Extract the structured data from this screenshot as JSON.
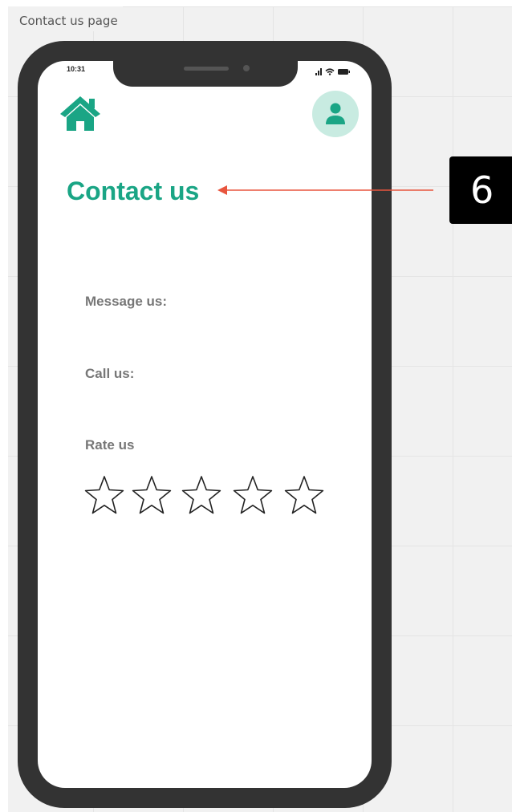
{
  "canvas": {
    "frame_label": "Contact us page"
  },
  "status_bar": {
    "time": "10:31"
  },
  "header": {
    "home_icon": "home-icon",
    "profile_icon": "user-icon"
  },
  "main": {
    "title": "Contact us",
    "message_label": "Message us:",
    "call_label": "Call us:",
    "rate_label": "Rate us",
    "rating": {
      "max": 5,
      "value": 0
    }
  },
  "annotation": {
    "badge": "6"
  },
  "colors": {
    "accent": "#1aa585",
    "avatar_bg": "#c8ebe1",
    "phone_frame": "#333333",
    "arrow": "#e8553e",
    "label": "#777777"
  }
}
